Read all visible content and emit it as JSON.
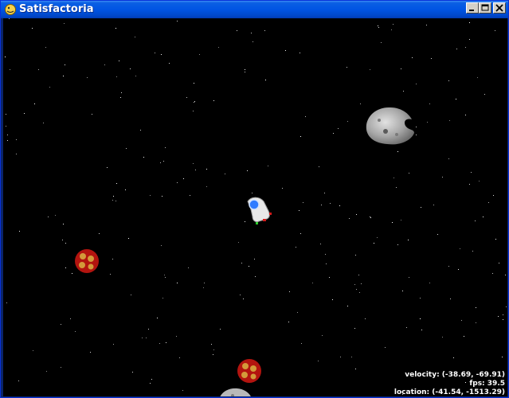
{
  "window": {
    "title": "Satisfactoria"
  },
  "icons": {
    "app": "pygame-snake-icon",
    "minimize": "minimize-icon",
    "maximize": "maximize-icon",
    "close": "close-icon"
  },
  "game": {
    "hud": {
      "velocity": "velocity: (-38.69, -69.91)",
      "fps": "fps: 39.5",
      "location": "location: (-41.54, -1513.29)"
    }
  },
  "colors": {
    "titlebar": "#0054e3",
    "space": "#000000",
    "asteroid_grey": "#a6a6a6",
    "asteroid_red": "#b3140f",
    "asteroid_orange": "#d39a3a",
    "ship_hull": "#e8e8e8",
    "ship_cockpit": "#2e7bff"
  }
}
